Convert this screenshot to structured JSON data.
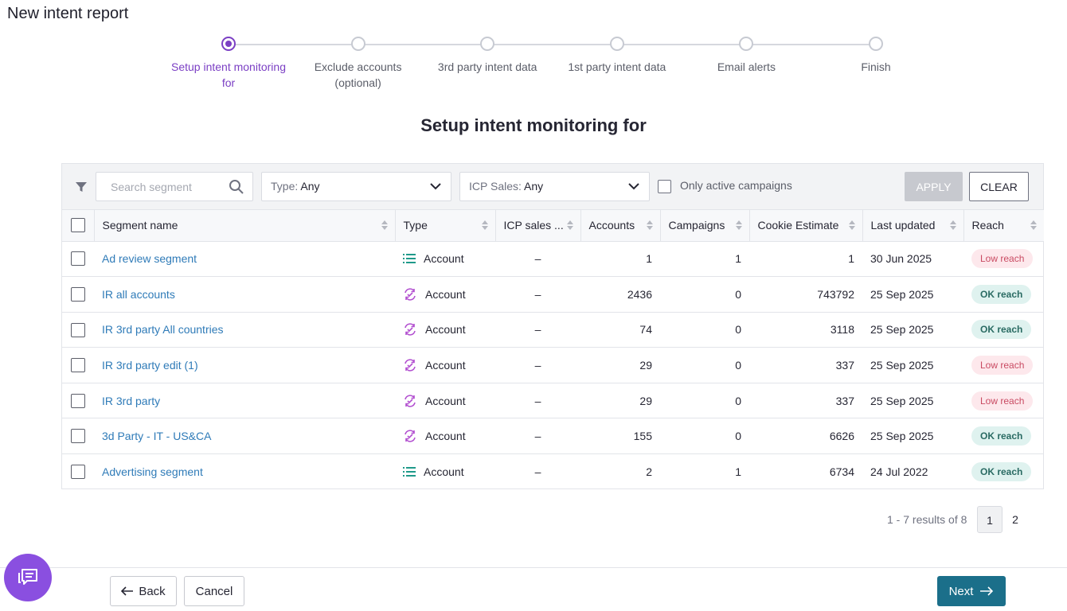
{
  "header": {
    "title": "New intent report"
  },
  "stepper": {
    "steps": [
      {
        "label": "Setup intent monitoring for",
        "active": true
      },
      {
        "label": "Exclude accounts (optional)",
        "active": false
      },
      {
        "label": "3rd party intent data",
        "active": false
      },
      {
        "label": "1st party intent data",
        "active": false
      },
      {
        "label": "Email alerts",
        "active": false
      },
      {
        "label": "Finish",
        "active": false
      }
    ]
  },
  "main": {
    "section_title": "Setup intent monitoring for"
  },
  "filters": {
    "search_placeholder": "Search segment",
    "type_label": "Type:",
    "type_value": "Any",
    "icp_label": "ICP Sales:",
    "icp_value": "Any",
    "only_active_label": "Only active campaigns",
    "apply_label": "APPLY",
    "clear_label": "CLEAR"
  },
  "table": {
    "columns": [
      "Segment name",
      "Type",
      "ICP sales ...",
      "Accounts",
      "Campaigns",
      "Cookie Estimate",
      "Last updated",
      "Reach"
    ],
    "rows": [
      {
        "name": "Ad review segment",
        "type_icon": "list-icon",
        "type": "Account",
        "icp": "–",
        "accounts": "1",
        "campaigns": "1",
        "cookie": "1",
        "updated": "30 Jun 2025",
        "reach": "Low reach"
      },
      {
        "name": "IR all accounts",
        "type_icon": "sync-icon",
        "type": "Account",
        "icp": "–",
        "accounts": "2436",
        "campaigns": "0",
        "cookie": "743792",
        "updated": "25 Sep 2025",
        "reach": "OK reach"
      },
      {
        "name": "IR 3rd party All countries",
        "type_icon": "sync-icon",
        "type": "Account",
        "icp": "–",
        "accounts": "74",
        "campaigns": "0",
        "cookie": "3118",
        "updated": "25 Sep 2025",
        "reach": "OK reach"
      },
      {
        "name": "IR 3rd party edit (1)",
        "type_icon": "sync-icon",
        "type": "Account",
        "icp": "–",
        "accounts": "29",
        "campaigns": "0",
        "cookie": "337",
        "updated": "25 Sep 2025",
        "reach": "Low reach"
      },
      {
        "name": "IR 3rd party",
        "type_icon": "sync-icon",
        "type": "Account",
        "icp": "–",
        "accounts": "29",
        "campaigns": "0",
        "cookie": "337",
        "updated": "25 Sep 2025",
        "reach": "Low reach"
      },
      {
        "name": "3d Party - IT - US&CA",
        "type_icon": "sync-icon",
        "type": "Account",
        "icp": "–",
        "accounts": "155",
        "campaigns": "0",
        "cookie": "6626",
        "updated": "25 Sep 2025",
        "reach": "OK reach"
      },
      {
        "name": "Advertising segment",
        "type_icon": "list-icon",
        "type": "Account",
        "icp": "–",
        "accounts": "2",
        "campaigns": "1",
        "cookie": "6734",
        "updated": "24 Jul 2022",
        "reach": "OK reach"
      }
    ]
  },
  "pagination": {
    "results": "1 - 7 results of 8",
    "pages": [
      "1",
      "2"
    ],
    "current": "1"
  },
  "footer": {
    "back_label": "Back",
    "cancel_label": "Cancel",
    "next_label": "Next"
  },
  "colors": {
    "accent": "#7b3fc4",
    "link": "#2f7bb8",
    "primary_button": "#1b6f8a",
    "low_reach": "#c94a62",
    "ok_reach": "#2a6b63"
  }
}
